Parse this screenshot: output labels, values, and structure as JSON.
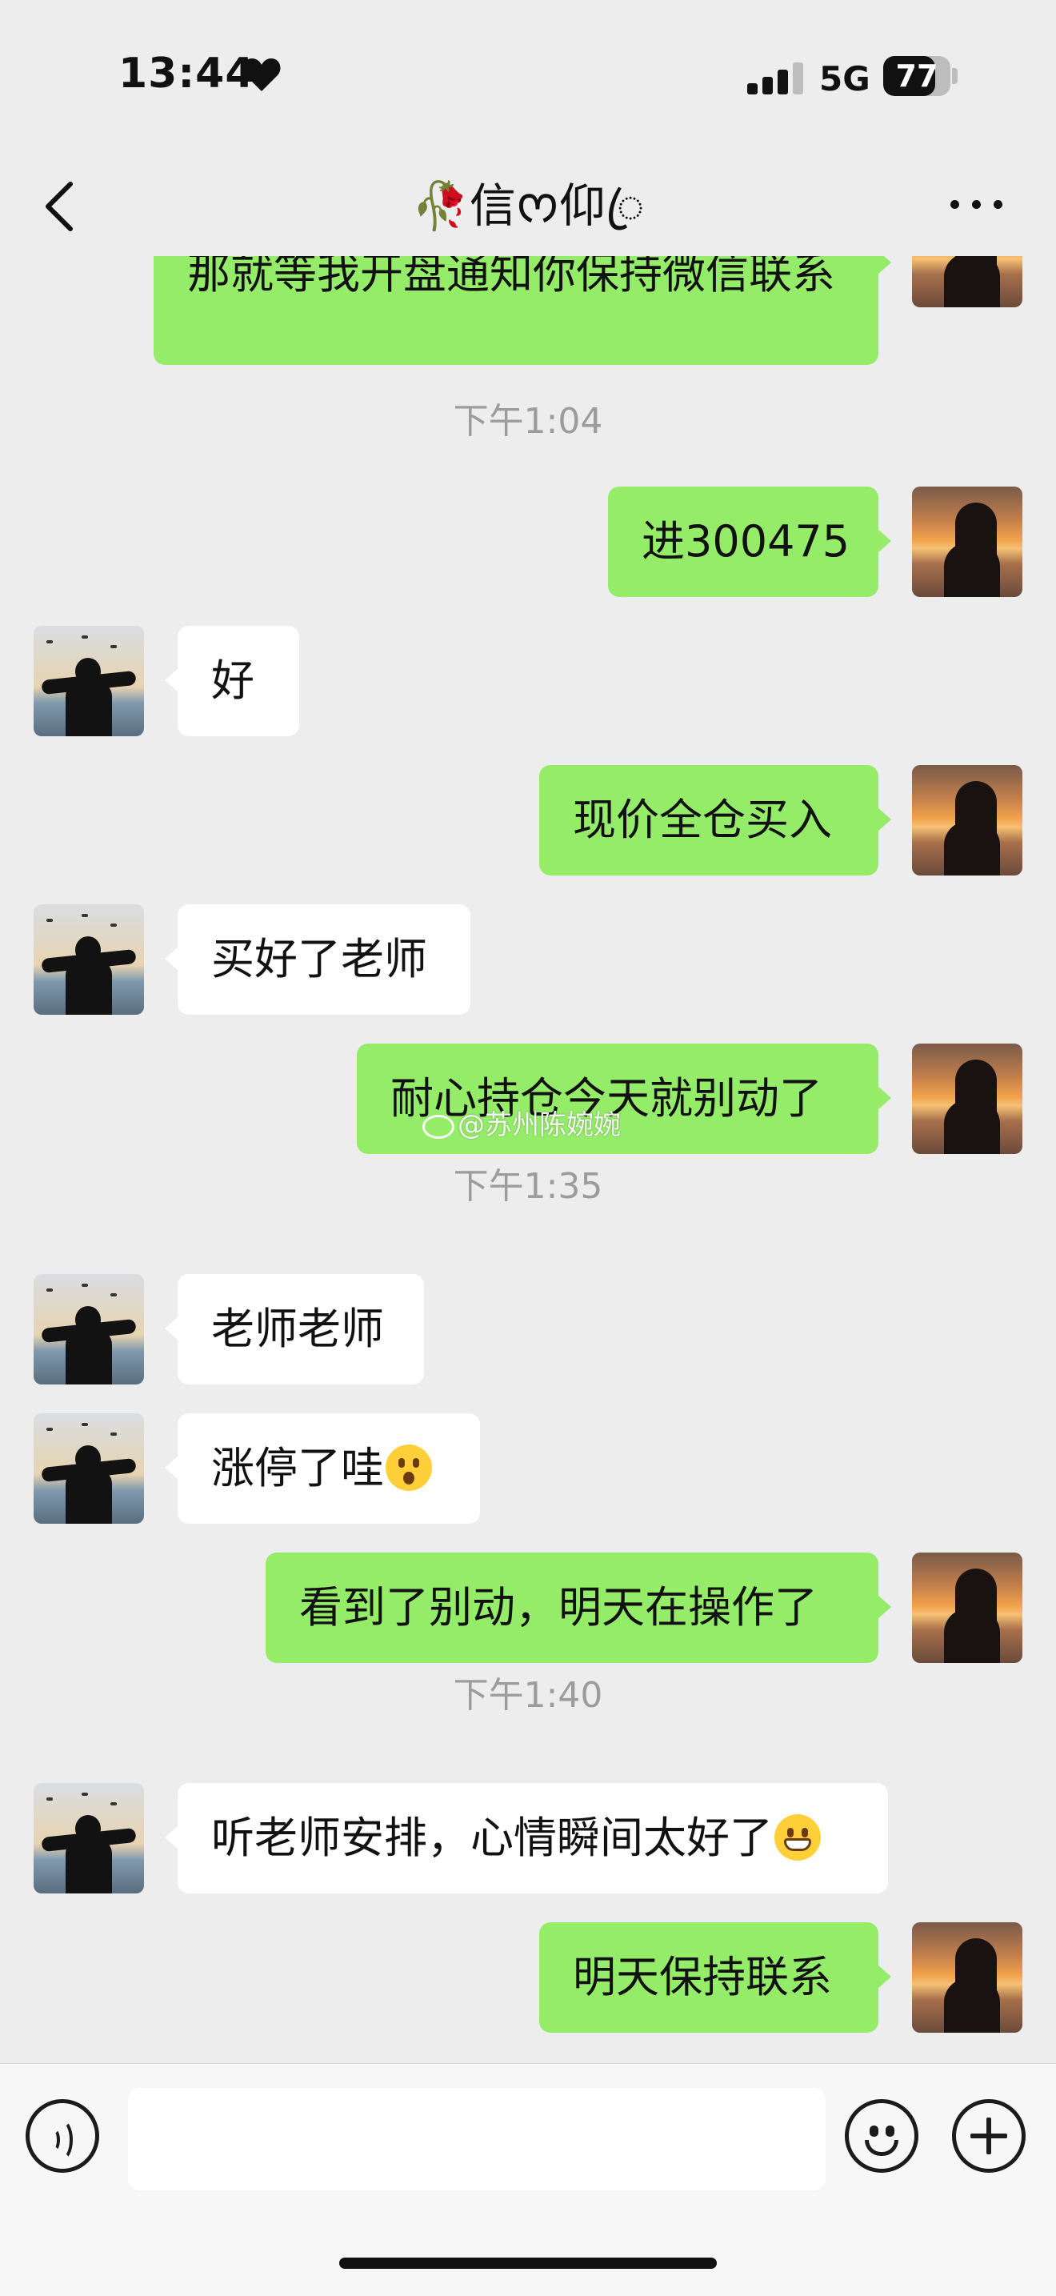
{
  "status_bar": {
    "time": "13:44",
    "network": "5G",
    "battery": "77",
    "battery_level": 0.77,
    "icons": [
      "heart-icon",
      "signal-icon",
      "battery-icon"
    ]
  },
  "header": {
    "title": "🥀信ᰔ仰ꦿ",
    "icons": [
      "chevron-left-icon",
      "more-icon"
    ]
  },
  "messages": [
    {
      "side": "mine",
      "text": "那就等我开盘通知你保持微信联系"
    },
    {
      "type": "time",
      "text": "下午1:04"
    },
    {
      "side": "mine",
      "text": "进300475"
    },
    {
      "side": "theirs",
      "text": "好"
    },
    {
      "side": "mine",
      "text": "现价全仓买入"
    },
    {
      "side": "theirs",
      "text": "买好了老师"
    },
    {
      "side": "mine",
      "text": "耐心持仓今天就别动了"
    },
    {
      "type": "time",
      "text": "下午1:35"
    },
    {
      "side": "theirs",
      "text": "老师老师"
    },
    {
      "side": "theirs",
      "text": "涨停了哇",
      "emoji": "hushed-face-emoji"
    },
    {
      "side": "mine",
      "text": "看到了别动，明天在操作了"
    },
    {
      "type": "time",
      "text": "下午1:40"
    },
    {
      "side": "theirs",
      "text": "听老师安排，心情瞬间太好了",
      "emoji": "grimacing-face-emoji"
    },
    {
      "side": "mine",
      "text": "明天保持联系"
    }
  ],
  "watermark": "@苏州陈婉婉",
  "input_bar": {
    "value": "",
    "icons": [
      "voice-icon",
      "emoji-icon",
      "plus-icon"
    ]
  },
  "colors": {
    "background": "#ededed",
    "my_bubble": "#95ec69",
    "their_bubble": "#ffffff",
    "timestamp": "#9c9c9c"
  }
}
